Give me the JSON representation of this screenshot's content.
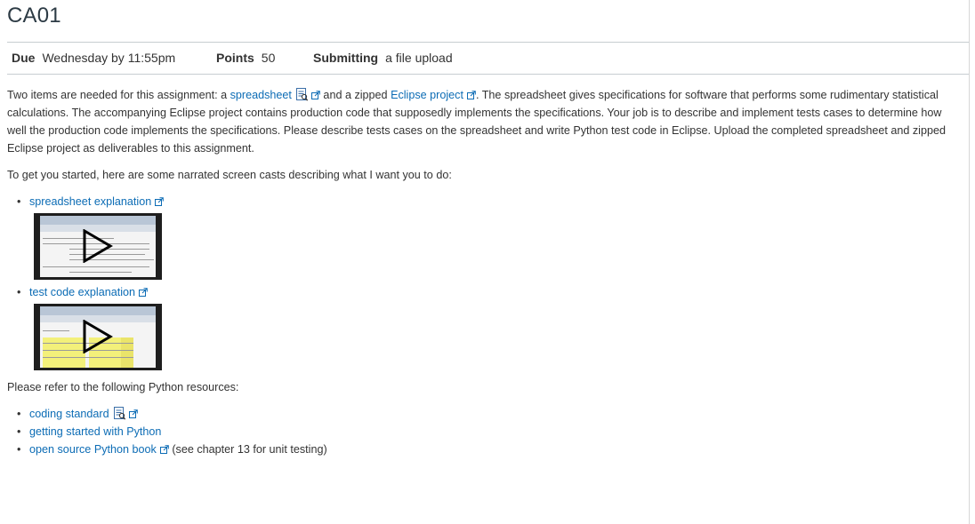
{
  "title": "CA01",
  "details": [
    {
      "label": "Due",
      "value": "Wednesday by 11:55pm"
    },
    {
      "label": "Points",
      "value": "50"
    },
    {
      "label": "Submitting",
      "value": "a file upload"
    }
  ],
  "intro": {
    "t1": "Two items are needed for this assignment:  a ",
    "link_spreadsheet": "spreadsheet",
    "t2": " and a zipped ",
    "link_eclipse": "Eclipse project",
    "t3": ".  The spreadsheet gives specifications for software that performs some rudimentary statistical calculations.   The accompanying Eclipse project contains production code that supposedly implements the specifications.   Your job is to describe and implement tests cases to determine how well the production code implements the specifications. Please describe tests cases on the spreadsheet and write Python test code in Eclipse.  Upload the completed spreadsheet and zipped Eclipse project as deliverables to this assignment."
  },
  "screencasts_intro": "To get you started, here are some narrated screen casts describing what I want you to do:",
  "screencasts": [
    {
      "label": "spreadsheet explanation",
      "thumb": "spreadsheet"
    },
    {
      "label": "test code explanation",
      "thumb": "testcode"
    }
  ],
  "resources_intro": "Please refer to the following Python resources:",
  "resources": [
    {
      "label": "coding standard",
      "suffix": ""
    },
    {
      "label": "getting started with Python",
      "suffix": ""
    },
    {
      "label": "open source Python book",
      "suffix": " (see chapter 13 for unit testing)"
    }
  ],
  "colors": {
    "link": "#0c6cb5",
    "text": "#333333",
    "title": "#2d3b45",
    "rule": "#c7cdd1"
  },
  "icons": [
    "external-link-icon",
    "document-preview-icon",
    "play-icon"
  ]
}
